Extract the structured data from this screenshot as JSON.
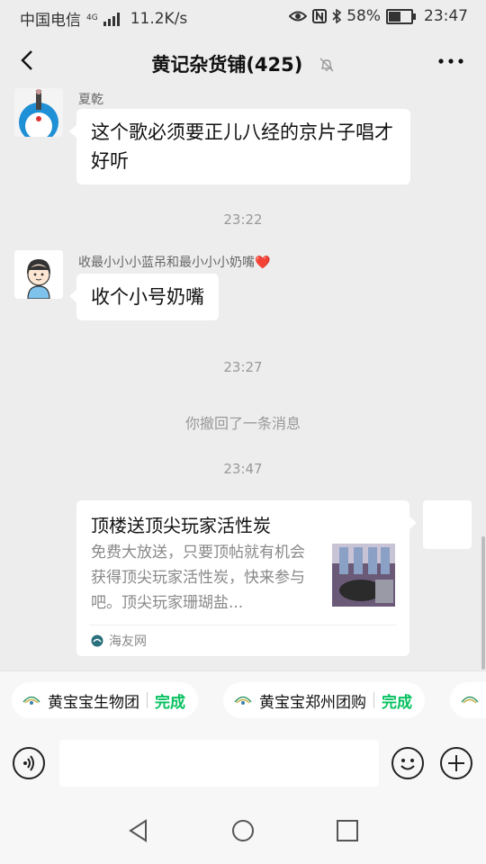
{
  "status_bar": {
    "carrier": "中国电信",
    "network_badge": "4G",
    "speed": "11.2K/s",
    "battery": "58%",
    "battery_level": 0.58,
    "time": "23:47"
  },
  "header": {
    "title": "黄记杂货铺(425)",
    "icons": [
      "back-icon",
      "mute-icon",
      "more-icon"
    ]
  },
  "messages": [
    {
      "sender": "夏乾",
      "text": "这个歌必须要正儿八经的京片子唱才好听"
    },
    {
      "time": "23:22"
    },
    {
      "sender": "收最小小小蓝吊和最小小小奶嘴❤️",
      "text": "收个小号奶嘴"
    },
    {
      "time": "23:27"
    },
    {
      "system": "你撤回了一条消息"
    },
    {
      "time": "23:47"
    },
    {
      "card_title": "顶楼送顶尖玩家活性炭",
      "card_desc": "免费大放送，只要顶帖就有机会获得顶尖玩家活性炭，快来参与吧。顶尖玩家珊瑚盐...",
      "card_source": "海友网"
    }
  ],
  "chips": [
    {
      "name": "黄宝宝生物团",
      "status": "完成"
    },
    {
      "name": "黄宝宝郑州团购",
      "status": "完成"
    }
  ],
  "input_bar": {
    "value": "",
    "icons": [
      "voice-icon",
      "emoji-icon",
      "plus-icon"
    ]
  },
  "nav_bar": {
    "icons": [
      "nav-back-icon",
      "nav-home-icon",
      "nav-recent-icon"
    ]
  },
  "colors": {
    "accent": "#07c160",
    "background": "#ededed"
  }
}
